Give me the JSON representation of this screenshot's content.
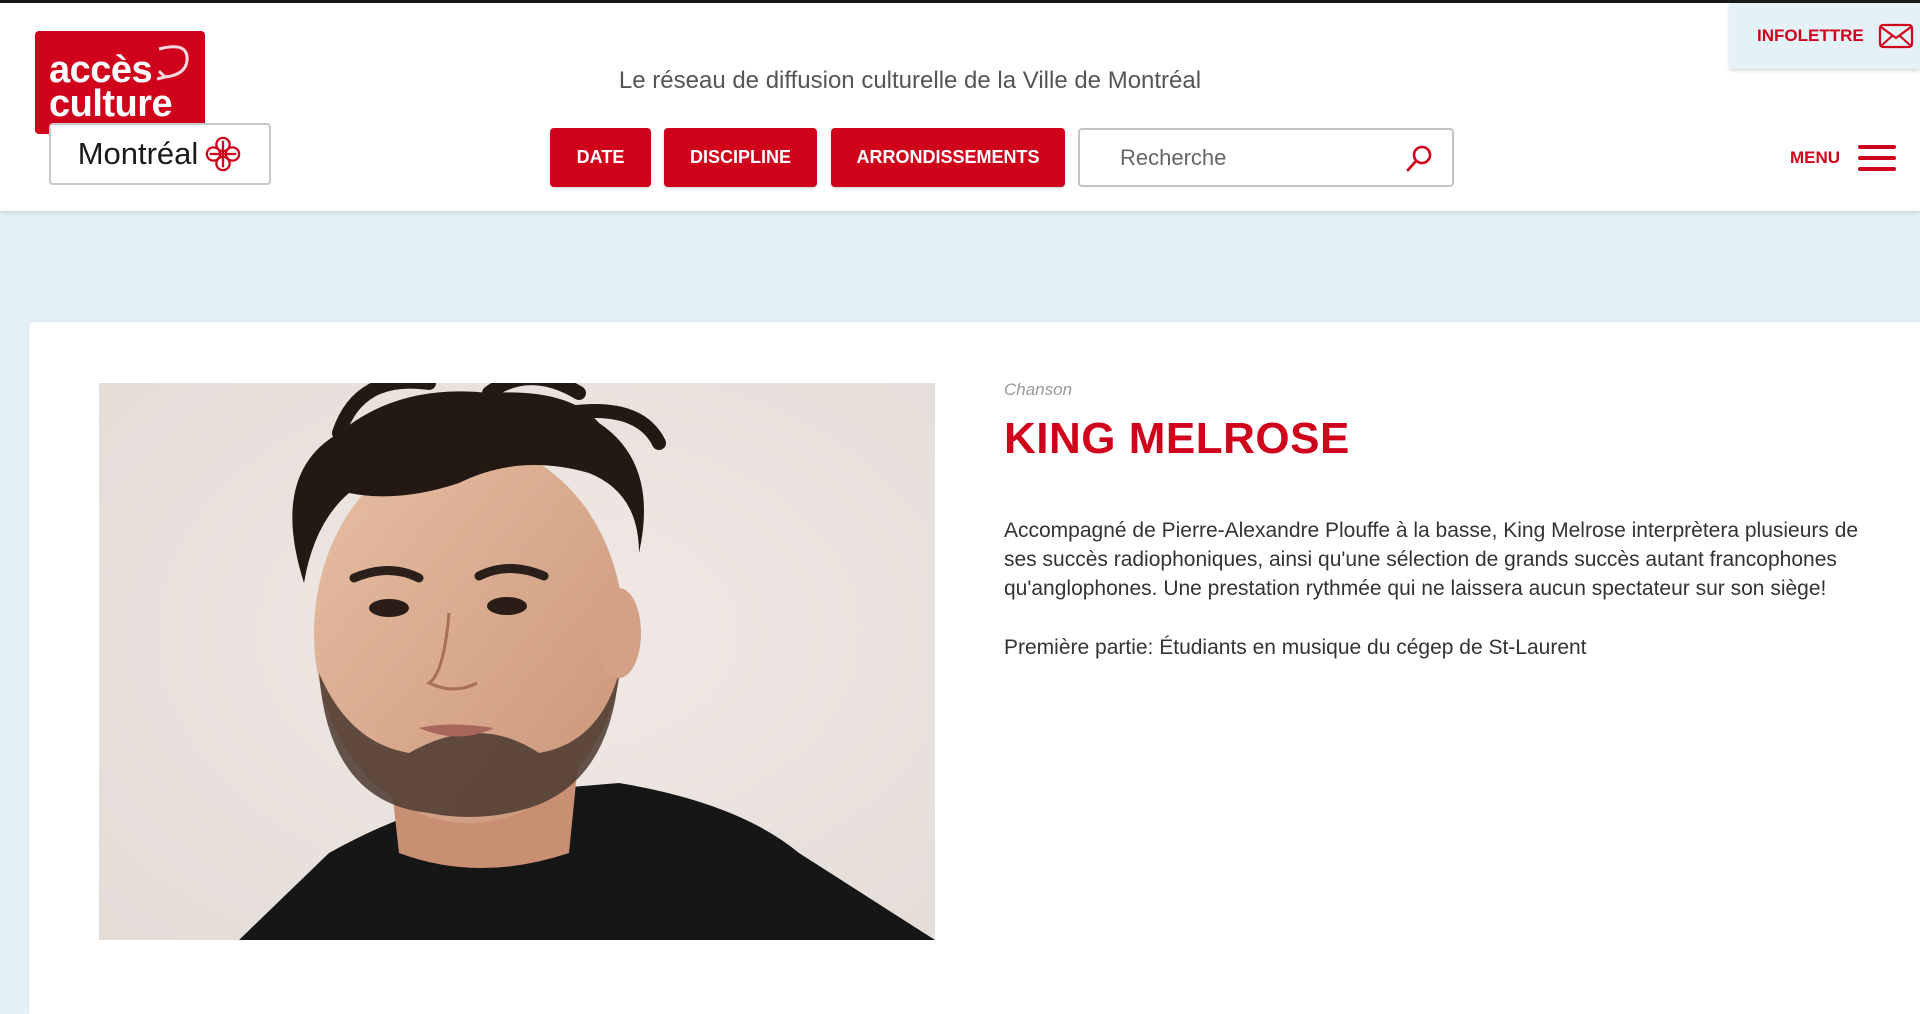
{
  "header": {
    "logo": {
      "line1": "accès",
      "line2": "culture",
      "city": "Montréal"
    },
    "tagline": "Le réseau de diffusion culturelle de la Ville de Montréal",
    "nav": {
      "date": "DATE",
      "discipline": "DISCIPLINE",
      "arrondissements": "ARRONDISSEMENTS"
    },
    "search": {
      "placeholder": "Recherche",
      "value": ""
    },
    "infolettre": "INFOLETTRE",
    "menu": "MENU"
  },
  "event": {
    "category": "Chanson",
    "title": "KING MELROSE",
    "description": "Accompagné de Pierre-Alexandre Plouffe à la basse, King Melrose interprètera plusieurs de ses succès radiophoniques, ainsi qu'une sélection de grands succès autant francophones qu'anglophones. Une prestation rythmée qui ne laissera aucun spectateur sur son siège!",
    "opening_act": "Première partie: Étudiants en musique du cégep de St-Laurent"
  },
  "colors": {
    "brand_red": "#d0021b",
    "page_bg": "#e4f2f8",
    "text": "#333333"
  },
  "icons": {
    "search": "magnifier-icon",
    "newsletter": "envelope-icon",
    "menu": "hamburger-icon",
    "city_logo": "montreal-rosette-icon"
  }
}
